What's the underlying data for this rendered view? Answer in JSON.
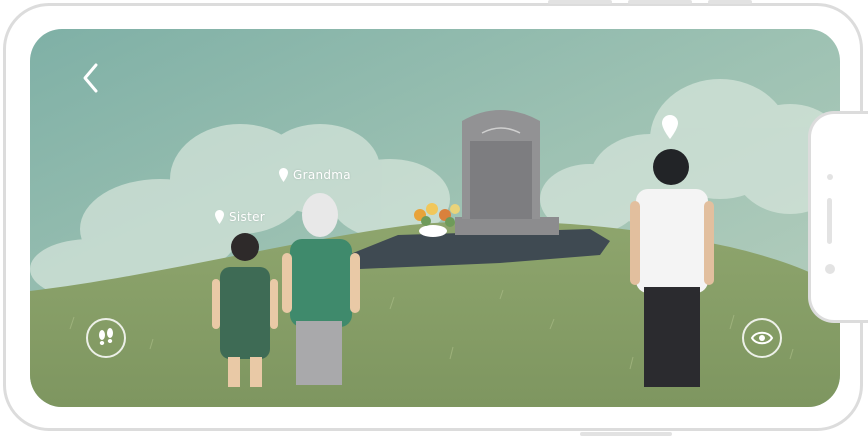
{
  "scene": {
    "characters": [
      {
        "id": "sister",
        "label": "Sister"
      },
      {
        "id": "grandma",
        "label": "Grandma"
      }
    ],
    "colors": {
      "sky": "#9cc0b1",
      "grass": "#8fa46e",
      "stone": "#8a8a8c",
      "sister_dress": "#3e6b55",
      "grandma_shirt": "#3f8a6c"
    }
  },
  "controls": {
    "back_icon": "chevron-left-icon",
    "walk_icon": "footprints-icon",
    "view_icon": "eye-icon"
  }
}
